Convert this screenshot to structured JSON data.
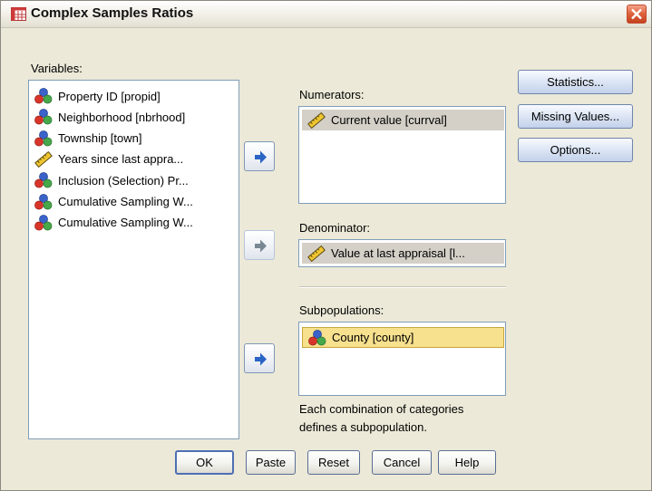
{
  "window": {
    "title": "Complex Samples Ratios"
  },
  "variables": {
    "label": "Variables:",
    "items": [
      {
        "label": "Property ID [propid]",
        "icon": "nominal-variable-icon"
      },
      {
        "label": "Neighborhood [nbrhood]",
        "icon": "nominal-variable-icon"
      },
      {
        "label": "Township [town]",
        "icon": "nominal-variable-icon"
      },
      {
        "label": "Years since last appra...",
        "icon": "scale-variable-icon"
      },
      {
        "label": "Inclusion (Selection) Pr...",
        "icon": "nominal-variable-icon"
      },
      {
        "label": "Cumulative Sampling W...",
        "icon": "nominal-variable-icon"
      },
      {
        "label": "Cumulative Sampling W...",
        "icon": "nominal-variable-icon"
      }
    ]
  },
  "numerators": {
    "label": "Numerators:",
    "items": [
      {
        "label": "Current value [currval]",
        "icon": "scale-variable-icon"
      }
    ]
  },
  "denominator": {
    "label": "Denominator:",
    "value": "Value at last appraisal [l...",
    "icon": "scale-variable-icon"
  },
  "subpopulations": {
    "label": "Subpopulations:",
    "items": [
      {
        "label": "County [county]",
        "icon": "nominal-variable-icon"
      }
    ],
    "note_line1": "Each combination of categories",
    "note_line2": "defines a subpopulation."
  },
  "side_buttons": {
    "statistics": "Statistics...",
    "missing_values": "Missing Values...",
    "options": "Options..."
  },
  "bottom_buttons": {
    "ok": "OK",
    "paste": "Paste",
    "reset": "Reset",
    "cancel": "Cancel",
    "help": "Help"
  },
  "colors": {
    "dialog_bg": "#ece9d8",
    "selected_gray": "#d4d0c8",
    "selected_yellow": "#f7e08e",
    "arrow_blue": "#2a64c4",
    "close_red": "#d9532f"
  }
}
